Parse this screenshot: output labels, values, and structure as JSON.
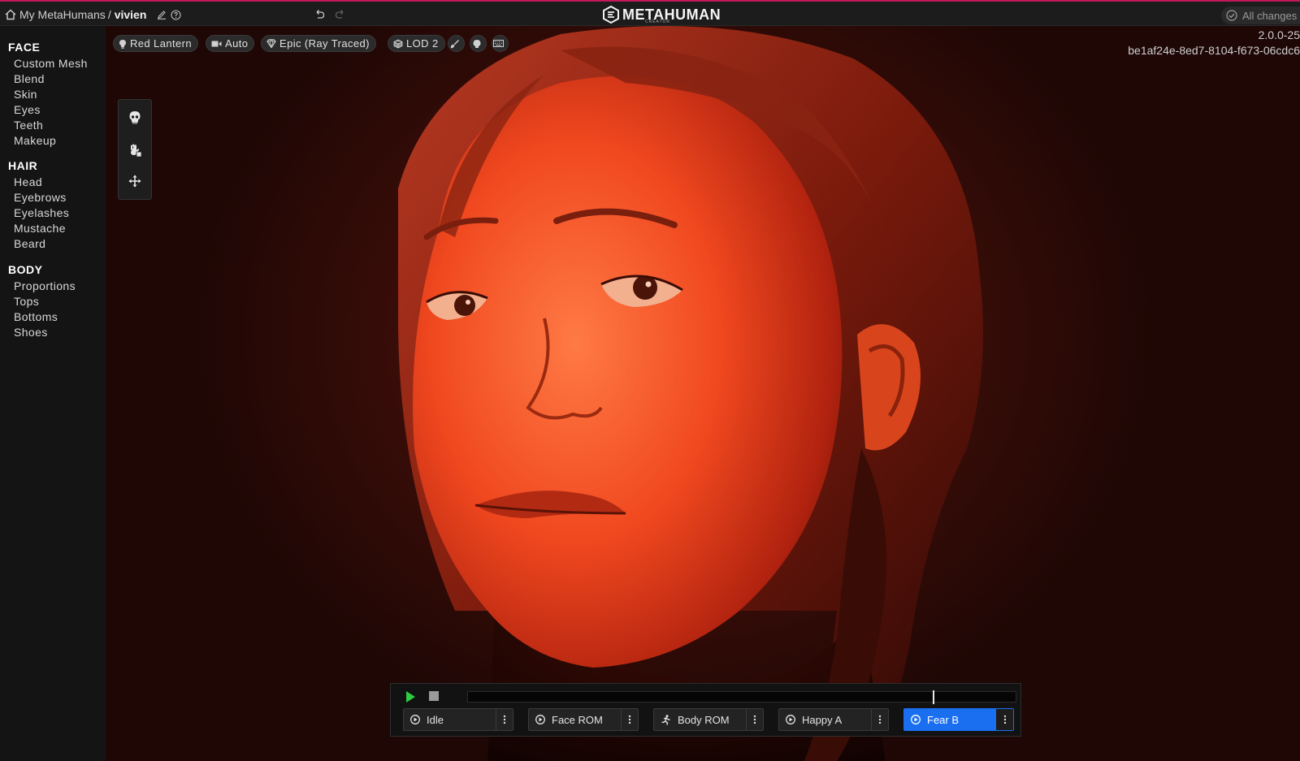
{
  "header": {
    "home_icon": "home-icon",
    "breadcrumb_parent": "My MetaHumans",
    "breadcrumb_separator": "/",
    "breadcrumb_current": "vivien",
    "rename_icon": "pencil-icon",
    "help_icon": "help-circle-icon",
    "undo_icon": "undo-icon",
    "redo_icon": "redo-icon",
    "brand_name": "METAHUMAN",
    "brand_sub": "CREATOR",
    "save_status": "All changes saved"
  },
  "sidebar": {
    "sections": [
      {
        "title": "FACE",
        "items": [
          "Custom Mesh",
          "Blend",
          "Skin",
          "Eyes",
          "Teeth",
          "Makeup"
        ]
      },
      {
        "title": "HAIR",
        "items": [
          "Head",
          "Eyebrows",
          "Eyelashes",
          "Mustache",
          "Beard"
        ]
      },
      {
        "title": "BODY",
        "items": [
          "Proportions",
          "Tops",
          "Bottoms",
          "Shoes"
        ]
      }
    ]
  },
  "viewport": {
    "lighting": "Red Lantern",
    "camera": "Auto",
    "quality": "Epic (Ray Traced)",
    "lod": "LOD 2",
    "version": "2.0.0-25",
    "guid": "be1af24e-8ed7-8104-f673-06cdc6"
  },
  "colors": {
    "accent_bar": "#c2185b",
    "active_clip": "#1a6ff0",
    "play_green": "#2ecc40",
    "backdrop": "#3a0d08"
  },
  "animation": {
    "playhead_fraction": 0.851,
    "clips": [
      {
        "label": "Idle",
        "icon": "face-play-icon",
        "active": false
      },
      {
        "label": "Face ROM",
        "icon": "face-play-icon",
        "active": false
      },
      {
        "label": "Body ROM",
        "icon": "running-figure-icon",
        "active": false
      },
      {
        "label": "Happy A",
        "icon": "face-play-icon",
        "active": false
      },
      {
        "label": "Fear B",
        "icon": "face-play-icon",
        "active": true
      }
    ]
  }
}
